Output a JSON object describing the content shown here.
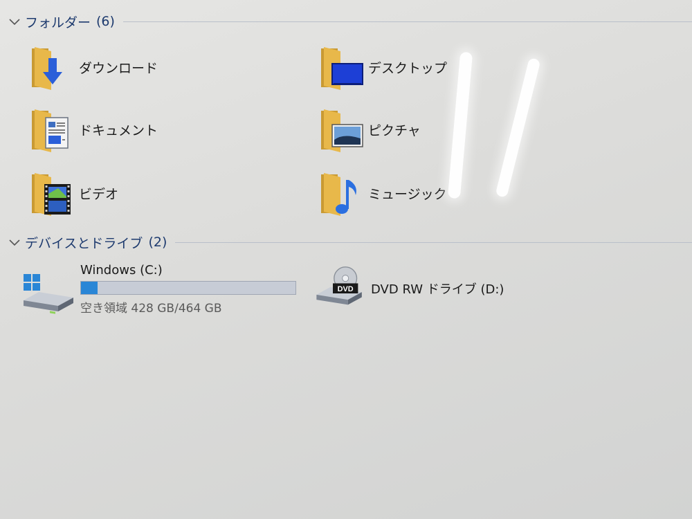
{
  "folders_section": {
    "title": "フォルダー",
    "count": "(6)",
    "items": [
      {
        "label": "ダウンロード",
        "icon": "download-folder-icon"
      },
      {
        "label": "デスクトップ",
        "icon": "desktop-folder-icon"
      },
      {
        "label": "ドキュメント",
        "icon": "documents-folder-icon"
      },
      {
        "label": "ピクチャ",
        "icon": "pictures-folder-icon"
      },
      {
        "label": "ビデオ",
        "icon": "videos-folder-icon"
      },
      {
        "label": "ミュージック",
        "icon": "music-folder-icon"
      }
    ]
  },
  "devices_section": {
    "title": "デバイスとドライブ",
    "count": "(2)",
    "drives": [
      {
        "name": "Windows (C:)",
        "free_text": "空き領域 428 GB/464 GB",
        "used_fraction": 0.078,
        "icon": "windows-drive-icon"
      },
      {
        "name": "DVD RW ドライブ (D:)",
        "icon": "dvd-drive-icon",
        "badge": "DVD"
      }
    ]
  },
  "colors": {
    "accent": "#2a86d6",
    "header": "#1d3a6e",
    "folder": "#e8b84a"
  }
}
